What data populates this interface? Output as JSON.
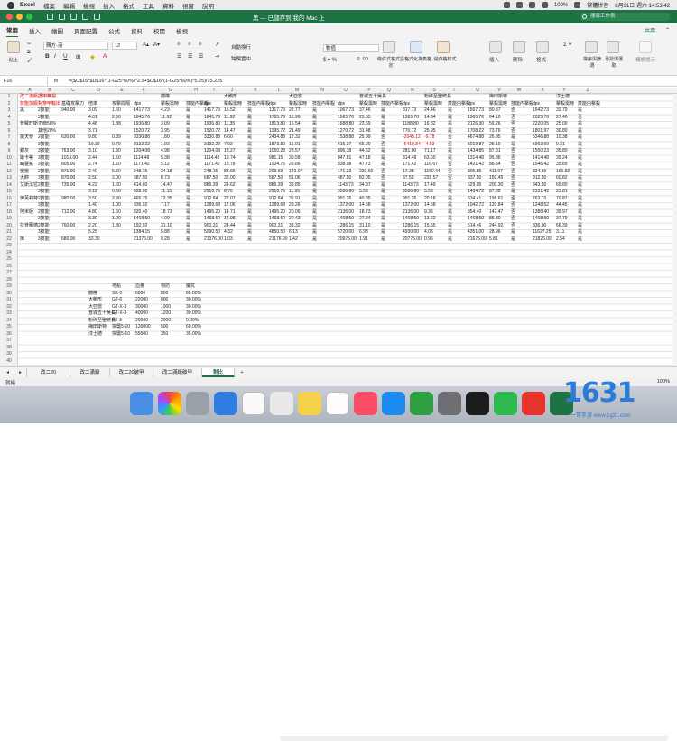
{
  "menubar": {
    "app": "Excel",
    "items": [
      "檔案",
      "編輯",
      "檢視",
      "插入",
      "格式",
      "工具",
      "資料",
      "視窗",
      "說明"
    ],
    "battery": "100%",
    "input_method": "繁體拼音",
    "datetime": "8月31日 週六 14:53:42"
  },
  "window": {
    "title": "黑 — 已儲存到 我的 Mac 上",
    "search_placeholder": "搜尋工作表"
  },
  "ribbon_tabs": [
    "常用",
    "插入",
    "繪圖",
    "頁面配置",
    "公式",
    "資料",
    "校閱",
    "檢視"
  ],
  "ribbon": {
    "share": "共用",
    "paste": "貼上",
    "font": "蘋方-港",
    "size": "12",
    "wrap": "自動換行",
    "merge": "跨欄置中",
    "number_format": "數值",
    "cond_format": "條件式格式設定",
    "format_table": "格式化為表格",
    "cell_styles": "儲存格樣式",
    "insert": "插入",
    "delete": "刪除",
    "format": "格式",
    "sort_filter": "排序與篩選",
    "find_select": "尋找與選取",
    "ideas": "構想提示"
  },
  "formula_bar": {
    "cell": "F16",
    "fx": "fx",
    "formula": "=($C$16*$D$16*(1-G25*60%)*2.9+$C$16*(1-G25*60%)*5.25)/15.225"
  },
  "columns": [
    "A",
    "B",
    "C",
    "D",
    "E",
    "F",
    "G",
    "H",
    "I",
    "J",
    "K",
    "L",
    "M",
    "N",
    "O",
    "P",
    "Q",
    "R",
    "S",
    "T",
    "U",
    "V",
    "W",
    "X",
    "Y",
    "Z"
  ],
  "rows": [
    "1",
    "2",
    "3",
    "4",
    "5",
    "6",
    "7",
    "8",
    "9",
    "10",
    "11",
    "12",
    "13",
    "14",
    "15",
    "16",
    "17",
    "18",
    "19",
    "20",
    "21",
    "22",
    "23",
    "24",
    "25",
    "26",
    "27",
    "28",
    "29",
    "30",
    "31",
    "32",
    "33",
    "34",
    "35",
    "36",
    "37",
    "38",
    "39",
    "40"
  ],
  "header_row1": [
    "改二滿級",
    "護甲無視",
    "",
    "",
    "",
    "",
    "體瞳",
    "",
    "",
    "大鵝形",
    "",
    "",
    "大亞當",
    "",
    "",
    "普城五十吳長",
    "",
    "",
    "粉碎至聖統長",
    "",
    "",
    "梅田斯特",
    "",
    "",
    "淳士德"
  ],
  "header_row2": [
    "技能加級",
    "對穿甲輸出",
    "基礎攻擊力",
    "倍率",
    "攻擊間隔",
    "dps",
    "擊殺需時",
    "技能內擊殺",
    "dps",
    "擊殺需時",
    "技能內擊殺",
    "dps",
    "擊殺需時",
    "技能內擊殺",
    "dps",
    "擊殺需時",
    "技能內擊殺",
    "dps",
    "擊殺需時",
    "技能內擊殺",
    "dps",
    "擊殺需時",
    "技能內擊殺",
    "dps",
    "擊殺需時",
    "技能內擊殺"
  ],
  "table": [
    [
      "黑",
      "2技能",
      "940.00",
      "3.09",
      "1.60",
      "1417.73",
      "4.23",
      "是",
      "1417.73",
      "15.52",
      "是",
      "1317.73",
      "22.77",
      "是",
      "1067.73",
      "37.46",
      "是",
      "817.73",
      "24.46",
      "是",
      "1567.73",
      "80.37",
      "否",
      "1642.73",
      "33.79",
      "是"
    ],
    [
      "",
      "3技能",
      "",
      "4.61",
      "2.00",
      "1845.76",
      "11.92",
      "是",
      "1845.76",
      "11.92",
      "是",
      "1765.76",
      "16.99",
      "是",
      "1565.76",
      "25.55",
      "是",
      "1365.76",
      "14.64",
      "是",
      "1965.76",
      "64.10",
      "否",
      "2025.76",
      "27.40",
      "否"
    ],
    [
      "普羅旺斯",
      "正面50%",
      "",
      "4.48",
      "1.88",
      "1936.80",
      "3.09",
      "是",
      "1936.80",
      "11.35",
      "是",
      "1813.80",
      "16.54",
      "是",
      "1688.80",
      "23.69",
      "是",
      "1188.80",
      "16.82",
      "是",
      "2126.30",
      "59.26",
      "否",
      "2220.05",
      "25.00",
      "是"
    ],
    [
      "",
      "其他20%",
      "",
      "3.71",
      "",
      "1520.72",
      "3.95",
      "是",
      "1520.72",
      "14.47",
      "是",
      "1395.72",
      "21.49",
      "是",
      "1270.72",
      "31.48",
      "是",
      "770.72",
      "25.95",
      "是",
      "1708.22",
      "73.76",
      "否",
      "1801.97",
      "30.80",
      "是"
    ],
    [
      "能天使",
      "2技能",
      "630.00",
      "9.80",
      "0.89",
      "3330.88",
      "1.80",
      "是",
      "3330.88",
      "6.60",
      "是",
      "2434.88",
      "12.32",
      "是",
      "1538.88",
      "25.99",
      "否",
      "-2045.12",
      "-9.78",
      "否",
      "4674.88",
      "26.95",
      "是",
      "5346.88",
      "10.38",
      "是"
    ],
    [
      "",
      "3技能",
      "",
      "10.30",
      "0.79",
      "3132.22",
      "1.92",
      "是",
      "3132.22",
      "7.02",
      "是",
      "1873.80",
      "16.01",
      "是",
      "615.37",
      "65.00",
      "否",
      "-6418.34",
      "-4.53",
      "否",
      "5019.87",
      "25.10",
      "是",
      "5963.69",
      "9.31",
      "是"
    ],
    [
      "銀灰",
      "3技能",
      "763.00",
      "3.10",
      "1.30",
      "1204.08",
      "4.98",
      "是",
      "1204.08",
      "18.27",
      "是",
      "1050.23",
      "28.57",
      "是",
      "896.38",
      "44.62",
      "是",
      "281.00",
      "71.17",
      "是",
      "1434.85",
      "87.81",
      "否",
      "1550.23",
      "35.80",
      "是"
    ],
    [
      "斯卡蒂",
      "3技能",
      "1013.00",
      "2.44",
      "1.50",
      "1114.48",
      "5.38",
      "是",
      "1114.48",
      "19.74",
      "是",
      "981.15",
      "30.58",
      "是",
      "847.81",
      "47.18",
      "是",
      "314.48",
      "63.60",
      "是",
      "1314.48",
      "95.86",
      "否",
      "1414.48",
      "39.24",
      "是"
    ],
    [
      "幽靈鯊",
      "3技能",
      "805.00",
      "2.74",
      "1.20",
      "1171.42",
      "5.12",
      "是",
      "1171.42",
      "18.78",
      "是",
      "1004.75",
      "29.86",
      "是",
      "838.08",
      "47.73",
      "是",
      "171.42",
      "116.67",
      "否",
      "1421.42",
      "88.64",
      "否",
      "1546.42",
      "35.89",
      "是"
    ],
    [
      "蠻蠻",
      "2技能",
      "871.00",
      "2.40",
      "5.20",
      "248.15",
      "24.18",
      "是",
      "248.15",
      "88.65",
      "是",
      "209.69",
      "143.07",
      "是",
      "171.23",
      "233.60",
      "否",
      "17.38",
      "1150.44",
      "否",
      "305.85",
      "411.97",
      "否",
      "334.69",
      "165.82",
      "是"
    ],
    [
      "大帥",
      "3技能",
      "870.00",
      "2.50",
      "2.00",
      "687.50",
      "8.73",
      "是",
      "687.50",
      "32.00",
      "是",
      "587.50",
      "51.06",
      "是",
      "487.50",
      "82.05",
      "否",
      "87.50",
      "228.57",
      "否",
      "837.50",
      "150.45",
      "否",
      "912.50",
      "60.82",
      "是"
    ],
    [
      "艾斯法拉",
      "2技能",
      "735.00",
      "4.22",
      "1.60",
      "414.60",
      "14.47",
      "是",
      "886.39",
      "24.62",
      "是",
      "886.39",
      "33.85",
      "是",
      "1143.73",
      "34.97",
      "是",
      "1143.73",
      "17.49",
      "是",
      "629.05",
      "200.30",
      "否",
      "843.50",
      "65.80",
      "是"
    ],
    [
      "",
      "3技能",
      "",
      "3.12",
      "0.50",
      "538.02",
      "11.15",
      "是",
      "2510.76",
      "8.76",
      "是",
      "2510.76",
      "11.95",
      "是",
      "3586.80",
      "5.58",
      "是",
      "3586.80",
      "5.58",
      "是",
      "1434.72",
      "87.82",
      "是",
      "2331.42",
      "23.81",
      "是"
    ],
    [
      "伊芙莉特",
      "2技能",
      "980.00",
      "3.50",
      "2.90",
      "465.75",
      "12.35",
      "是",
      "912.84",
      "27.07",
      "是",
      "912.84",
      "36.91",
      "是",
      "991.26",
      "40.35",
      "是",
      "991.26",
      "20.18",
      "是",
      "634.41",
      "198.61",
      "否",
      "763.10",
      "70.87",
      "是"
    ],
    [
      "",
      "3技能",
      "",
      "1.40",
      "1.00",
      "836.92",
      "7.17",
      "是",
      "1289.68",
      "17.06",
      "是",
      "1289.68",
      "23.26",
      "是",
      "1372.00",
      "14.58",
      "是",
      "1372.00",
      "14.58",
      "是",
      "1042.72",
      "120.84",
      "否",
      "1248.52",
      "44.45",
      "是"
    ],
    [
      "阿米婭",
      "2技能",
      "712.00",
      "4.80",
      "1.60",
      "320.40",
      "18.73",
      "是",
      "1495.20",
      "14.71",
      "是",
      "1495.20",
      "20.06",
      "是",
      "2136.00",
      "18.73",
      "是",
      "2136.00",
      "9.36",
      "是",
      "854.40",
      "147.47",
      "否",
      "1388.40",
      "39.97",
      "是"
    ],
    [
      "",
      "3技能",
      "",
      "3.30",
      "1.00",
      "1468.50",
      "4.09",
      "是",
      "1468.50",
      "14.98",
      "是",
      "1468.50",
      "20.43",
      "是",
      "1468.50",
      "27.24",
      "是",
      "1468.50",
      "13.62",
      "是",
      "1468.50",
      "85.80",
      "否",
      "1468.50",
      "37.79",
      "是"
    ],
    [
      "拉普蘭德",
      "2技能",
      "760.00",
      "2.20",
      "1.30",
      "192.92",
      "31.10",
      "是",
      "900.31",
      "24.44",
      "是",
      "900.31",
      "33.32",
      "是",
      "1286.15",
      "31.10",
      "是",
      "1286.15",
      "15.55",
      "是",
      "514.46",
      "244.92",
      "否",
      "836.00",
      "66.39",
      "是"
    ],
    [
      "",
      "3技能",
      "",
      "5.25",
      "",
      "1384.15",
      "5.88",
      "是",
      "5090.50",
      "4.32",
      "是",
      "4850.50",
      "6.13",
      "是",
      "5720.00",
      "6.98",
      "是",
      "4930.00",
      "4.06",
      "是",
      "4351.00",
      "28.96",
      "是",
      "11627.25",
      "3.11",
      "是"
    ],
    [
      "陳",
      "3技能",
      "680.00",
      "33.30",
      "",
      "21376.00",
      "0.28",
      "是",
      "21376.00",
      "1.03",
      "是",
      "21176.00",
      "1.42",
      "是",
      "20976.00",
      "1.91",
      "是",
      "20776.00",
      "0.96",
      "是",
      "21676.00",
      "5.81",
      "是",
      "21826.00",
      "2.54",
      "是"
    ]
  ],
  "enemy_table": {
    "headers": [
      "",
      "地點",
      "血量",
      "物防",
      "魔抗"
    ],
    "rows": [
      [
        "體瞳",
        "SK-5",
        "6000",
        "800",
        "85.00%"
      ],
      [
        "大鵝形",
        "GT-6",
        "22000",
        "800",
        "30.00%"
      ],
      [
        "大亞當",
        "GT-X-3",
        "30000",
        "1000",
        "30.00%"
      ],
      [
        "普城五十吳長",
        "GT-X-3",
        "40000",
        "1200",
        "30.00%"
      ],
      [
        "粉碎至聖統長",
        "H5-3",
        "20000",
        "2000",
        "0.00%"
      ],
      [
        "梅田斯特",
        "突襲5-10",
        "126000",
        "500",
        "60.00%"
      ],
      [
        "淳士德",
        "突襲5-10",
        "55500",
        "350",
        "35.00%"
      ]
    ]
  },
  "sheet_tabs": [
    "改二20",
    "改二滿級",
    "改二20破甲",
    "改二滿級破甲",
    "對比"
  ],
  "active_sheet": "對比",
  "status": "就緒",
  "zoom": "100%",
  "watermark": {
    "big": "1631",
    "small": "一哥手游 www.1g31.com"
  },
  "colors": {
    "excel_green": "#1f7244",
    "red": "#dd0000"
  }
}
